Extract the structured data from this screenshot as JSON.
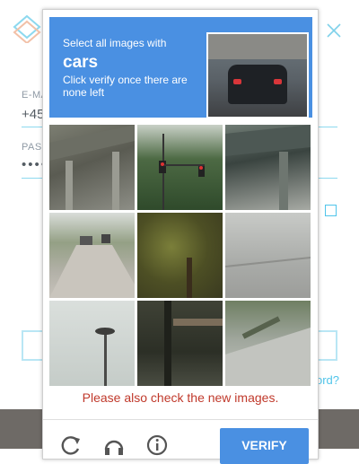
{
  "background": {
    "email_label": "E-MA",
    "email_value": "+45",
    "password_label": "PASS",
    "password_value": "••••",
    "forgot_link": "ord?"
  },
  "captcha": {
    "prompt_prefix": "Select all images with",
    "keyword": "cars",
    "instruction": "Click verify once there are none left",
    "notice": "Please also check the new images.",
    "verify_label": "VERIFY",
    "tiles": [
      {
        "id": 1
      },
      {
        "id": 2
      },
      {
        "id": 3
      },
      {
        "id": 4
      },
      {
        "id": 5
      },
      {
        "id": 6
      },
      {
        "id": 7
      },
      {
        "id": 8
      },
      {
        "id": 9
      }
    ],
    "footer_icons": [
      "reload-icon",
      "audio-icon",
      "info-icon"
    ]
  },
  "colors": {
    "accent": "#4a90e2",
    "notice": "#c0392b",
    "bg_accent": "#4fc4ea"
  }
}
